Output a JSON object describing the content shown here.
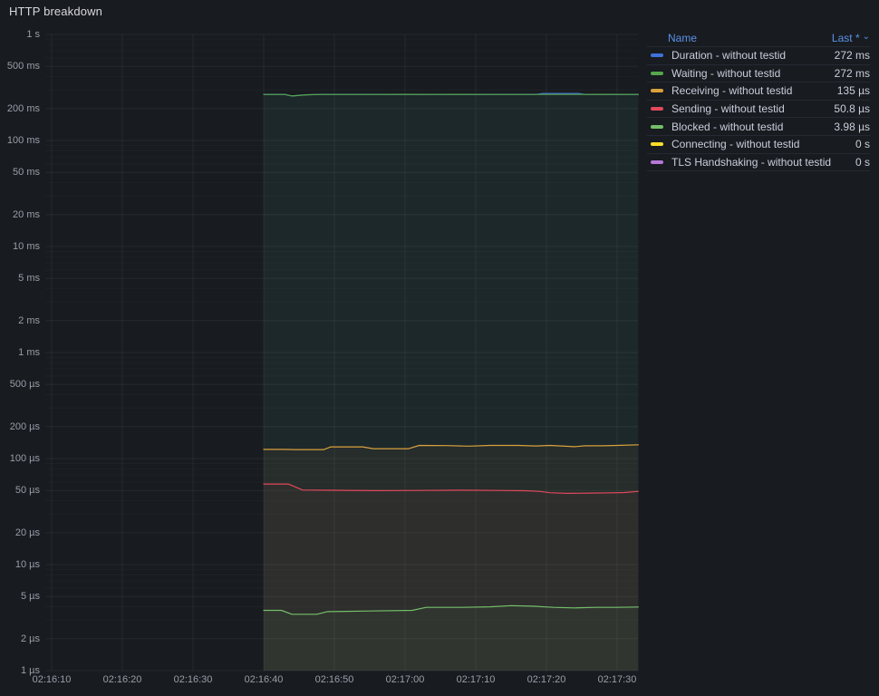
{
  "panel": {
    "title": "HTTP breakdown"
  },
  "colors": {
    "background": "#181b20",
    "grid_major": "rgba(210,220,235,0.07)",
    "grid_minor": "rgba(210,220,235,0.03)",
    "axis_text": "#9a9ea8",
    "legend_header_blue": "#5b91e8",
    "duration_blue": "#3d73db",
    "waiting_green": "#56a64b",
    "receiving_orange": "#d9a03c",
    "sending_red": "#e2495c",
    "blocked_green": "#73bf69",
    "connecting_yellow": "#fade2a",
    "tls_purple": "#b877d9"
  },
  "legend": {
    "name_header": "Name",
    "last_header": "Last *",
    "sort_caret": "⌄",
    "rows": [
      {
        "label": "Duration - without testid",
        "value": "272 ms",
        "color": "#3d73db"
      },
      {
        "label": "Waiting - without testid",
        "value": "272 ms",
        "color": "#56a64b"
      },
      {
        "label": "Receiving - without testid",
        "value": "135 µs",
        "color": "#d9a03c"
      },
      {
        "label": "Sending - without testid",
        "value": "50.8 µs",
        "color": "#e2495c"
      },
      {
        "label": "Blocked - without testid",
        "value": "3.98 µs",
        "color": "#73bf69"
      },
      {
        "label": "Connecting - without testid",
        "value": "0 s",
        "color": "#fade2a"
      },
      {
        "label": "TLS Handshaking - without testid",
        "value": "0 s",
        "color": "#b877d9"
      }
    ]
  },
  "chart_data": {
    "type": "line",
    "title": "HTTP breakdown",
    "legend_position": "right",
    "grid": true,
    "y_scale": "log",
    "ylim": [
      1e-06,
      1
    ],
    "y_ticks": [
      {
        "v": 1,
        "label": "1 s"
      },
      {
        "v": 0.5,
        "label": "500 ms"
      },
      {
        "v": 0.2,
        "label": "200 ms"
      },
      {
        "v": 0.1,
        "label": "100 ms"
      },
      {
        "v": 0.05,
        "label": "50 ms"
      },
      {
        "v": 0.02,
        "label": "20 ms"
      },
      {
        "v": 0.01,
        "label": "10 ms"
      },
      {
        "v": 0.005,
        "label": "5 ms"
      },
      {
        "v": 0.002,
        "label": "2 ms"
      },
      {
        "v": 0.001,
        "label": "1 ms"
      },
      {
        "v": 0.0005,
        "label": "500 µs"
      },
      {
        "v": 0.0002,
        "label": "200 µs"
      },
      {
        "v": 0.0001,
        "label": "100 µs"
      },
      {
        "v": 5e-05,
        "label": "50 µs"
      },
      {
        "v": 2e-05,
        "label": "20 µs"
      },
      {
        "v": 1e-05,
        "label": "10 µs"
      },
      {
        "v": 5e-06,
        "label": "5 µs"
      },
      {
        "v": 2e-06,
        "label": "2 µs"
      },
      {
        "v": 1e-06,
        "label": "1 µs"
      }
    ],
    "x_ticks": [
      {
        "t": 10,
        "label": "02:16:10"
      },
      {
        "t": 20,
        "label": "02:16:20"
      },
      {
        "t": 30,
        "label": "02:16:30"
      },
      {
        "t": 40,
        "label": "02:16:40"
      },
      {
        "t": 50,
        "label": "02:16:50"
      },
      {
        "t": 60,
        "label": "02:17:00"
      },
      {
        "t": 70,
        "label": "02:17:10"
      },
      {
        "t": 80,
        "label": "02:17:20"
      },
      {
        "t": 90,
        "label": "02:17:30"
      }
    ],
    "series": [
      {
        "id": "duration",
        "name": "Duration - without testid",
        "color": "#3d73db",
        "fill_opacity": 0.05,
        "last": "272 ms",
        "points": [
          [
            40,
            0.272
          ],
          [
            43,
            0.272
          ],
          [
            44,
            0.263
          ],
          [
            46,
            0.2695
          ],
          [
            48,
            0.272
          ],
          [
            56,
            0.272
          ],
          [
            64,
            0.272
          ],
          [
            72,
            0.272
          ],
          [
            78.5,
            0.272
          ],
          [
            79.5,
            0.2775
          ],
          [
            84.5,
            0.2775
          ],
          [
            85.5,
            0.272
          ],
          [
            90,
            0.272
          ],
          [
            93,
            0.272
          ]
        ]
      },
      {
        "id": "waiting",
        "name": "Waiting - without testid",
        "color": "#56a64b",
        "fill_opacity": 0.07,
        "last": "272 ms",
        "points": [
          [
            40,
            0.272
          ],
          [
            43,
            0.272
          ],
          [
            44,
            0.263
          ],
          [
            46,
            0.2695
          ],
          [
            48,
            0.272
          ],
          [
            56,
            0.272
          ],
          [
            60,
            0.2725
          ],
          [
            64,
            0.272
          ],
          [
            68,
            0.2725
          ],
          [
            72,
            0.272
          ],
          [
            76,
            0.272
          ],
          [
            80,
            0.272
          ],
          [
            84,
            0.272
          ],
          [
            88,
            0.2725
          ],
          [
            93,
            0.272
          ]
        ]
      },
      {
        "id": "receiving",
        "name": "Receiving - without testid",
        "color": "#d9a03c",
        "fill_opacity": 0.05,
        "last": "135 µs",
        "points": [
          [
            40,
            0.000122
          ],
          [
            43,
            0.000122
          ],
          [
            44.5,
            0.0001215
          ],
          [
            48.5,
            0.0001215
          ],
          [
            49.5,
            0.000129
          ],
          [
            54,
            0.000129
          ],
          [
            55.5,
            0.000124
          ],
          [
            60.5,
            0.000124
          ],
          [
            62,
            0.000133
          ],
          [
            66,
            0.0001325
          ],
          [
            69,
            0.000131
          ],
          [
            72,
            0.000133
          ],
          [
            76,
            0.000133
          ],
          [
            78.5,
            0.0001315
          ],
          [
            80.5,
            0.000133
          ],
          [
            84,
            0.0001295
          ],
          [
            85.5,
            0.000132
          ],
          [
            88,
            0.000132
          ],
          [
            90,
            0.000133
          ],
          [
            93,
            0.000135
          ]
        ]
      },
      {
        "id": "sending",
        "name": "Sending - without testid",
        "color": "#e2495c",
        "fill_opacity": 0.045,
        "last": "50.8 µs",
        "points": [
          [
            40,
            5.75e-05
          ],
          [
            43.5,
            5.75e-05
          ],
          [
            45.5,
            5.05e-05
          ],
          [
            50,
            5.02e-05
          ],
          [
            56,
            4.98e-05
          ],
          [
            62,
            5e-05
          ],
          [
            68,
            5.03e-05
          ],
          [
            73,
            5e-05
          ],
          [
            77,
            4.97e-05
          ],
          [
            79,
            4.9e-05
          ],
          [
            80.5,
            4.76e-05
          ],
          [
            83,
            4.7e-05
          ],
          [
            86,
            4.72e-05
          ],
          [
            89,
            4.75e-05
          ],
          [
            91,
            4.78e-05
          ],
          [
            93,
            4.9e-05
          ]
        ]
      },
      {
        "id": "blocked",
        "name": "Blocked - without testid",
        "color": "#73bf69",
        "fill_opacity": 0.05,
        "last": "3.98 µs",
        "points": [
          [
            40,
            3.7e-06
          ],
          [
            42.5,
            3.7e-06
          ],
          [
            44,
            3.4e-06
          ],
          [
            47.5,
            3.4e-06
          ],
          [
            49,
            3.6e-06
          ],
          [
            55,
            3.65e-06
          ],
          [
            61,
            3.7e-06
          ],
          [
            63,
            3.95e-06
          ],
          [
            68,
            3.95e-06
          ],
          [
            72,
            4e-06
          ],
          [
            75,
            4.1e-06
          ],
          [
            78,
            4.05e-06
          ],
          [
            81,
            3.95e-06
          ],
          [
            84,
            3.9e-06
          ],
          [
            87,
            3.95e-06
          ],
          [
            90,
            3.95e-06
          ],
          [
            93,
            3.98e-06
          ]
        ]
      },
      {
        "id": "connecting",
        "name": "Connecting - without testid",
        "color": "#fade2a",
        "fill_opacity": 0,
        "last": "0 s",
        "points": []
      },
      {
        "id": "tls",
        "name": "TLS Handshaking - without testid",
        "color": "#b877d9",
        "fill_opacity": 0,
        "last": "0 s",
        "points": []
      }
    ]
  }
}
